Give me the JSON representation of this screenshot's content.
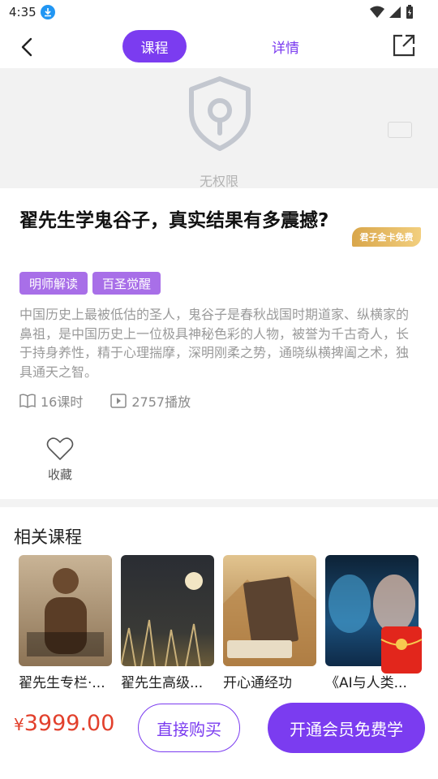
{
  "status_bar": {
    "time": "4:35"
  },
  "header": {
    "tabs": {
      "course": "课程",
      "detail": "详情"
    }
  },
  "player": {
    "no_permission_text": "无权限"
  },
  "course": {
    "title": "翟先生学鬼谷子，真实结果有多震撼?",
    "vip_badge": "君子金卡免费",
    "tags": [
      "明师解读",
      "百圣觉醒"
    ],
    "description": "中国历史上最被低估的圣人，鬼谷子是春秋战国时期道家、纵横家的鼻祖，是中国历史上一位极具神秘色彩的人物，被誉为千古奇人，长于持身养性，精于心理揣摩，深明刚柔之势，通晓纵横捭阖之术，独具通天之智。",
    "lessons": "16课时",
    "plays": "2757播放",
    "favorite_label": "收藏"
  },
  "related": {
    "title": "相关课程",
    "items": [
      {
        "name": "翟先生专栏·..."
      },
      {
        "name": "翟先生高级..."
      },
      {
        "name": "开心通经功"
      },
      {
        "name": "《AI与人类..."
      }
    ]
  },
  "bottom_bar": {
    "currency": "¥",
    "price": "3999.00",
    "buy_label": "直接购买",
    "vip_label": "开通会员免费学"
  },
  "colors": {
    "accent": "#7b3cf0",
    "price": "#e2402c",
    "tag": "#a86fe8"
  }
}
